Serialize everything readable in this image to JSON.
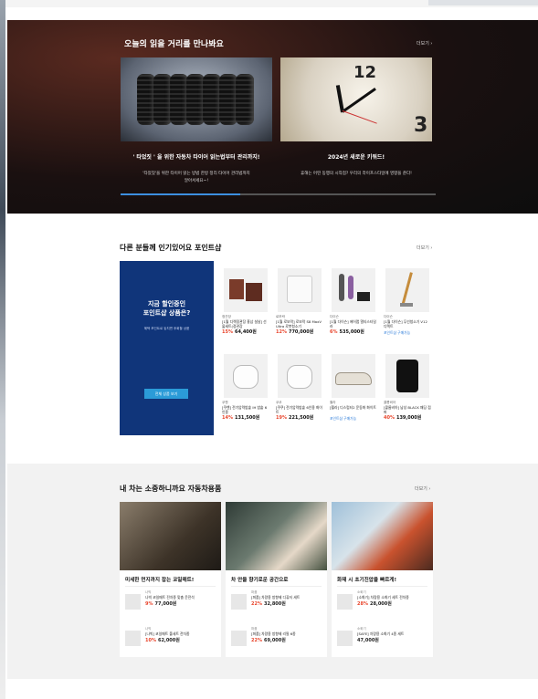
{
  "hero": {
    "title": "오늘의 읽을 거리를 만나봐요",
    "more": "더보기 ›",
    "cards": [
      {
        "title": "' 타었짓 ' 을 위한 자동차 타이어 읽는법부터 관리까지!",
        "desc_1": "'타었짓'을 위한 타이어 읽는 방법 한방 정리 타이어 관리법까지",
        "desc_2": "알아서세요~!"
      },
      {
        "title": "2024년 새로운 키워드!",
        "desc_1": "휴해는 어떤 동행의 시작점? 우리의 라이프스타일에 영향을 준다!",
        "desc_2": ""
      }
    ],
    "clock_digits": "12",
    "clock_small": "3",
    "progress_fraction": 0.38
  },
  "popular": {
    "title": "다른 분들께 인기있어요 포인트샵",
    "more": "더보기 ›",
    "promo_title_1": "지금 할인중인",
    "promo_title_2": "포인트샵 상품은?",
    "promo_sub": "혜택 포인트로 놓치면 후회할 상품",
    "promo_button": "전체 상품 보기",
    "products": [
      {
        "brand": "정관장",
        "name": "[1월 디렉정관장 홍삼 설날] 선물세트(정관장",
        "orig": "",
        "discount": "15%",
        "price": "64,400원",
        "tag": "",
        "icon": "gift-box-icon"
      },
      {
        "brand": "로보락",
        "name": "[1월 로보락] 로보락 S8 MaxV Ultra 로봇청소기",
        "orig": "",
        "discount": "12%",
        "price": "770,000원",
        "tag": "",
        "icon": "robot-vacuum-icon"
      },
      {
        "brand": "다이슨",
        "name": "[1월 다이슨] 에어랩 멀티스타일러",
        "orig": "",
        "discount": "6%",
        "price": "535,000원",
        "tag": "",
        "icon": "hair-styler-icon"
      },
      {
        "brand": "다이슨",
        "name": "[1월 다이슨] 무선청소기 V12 디텍트",
        "orig": "",
        "discount": "",
        "price": "",
        "tag": "포인트샵 구매가능",
        "icon": "stick-vacuum-icon"
      },
      {
        "brand": "쿠첸",
        "name": "[쿠첸] 전기압력밥솥 IH 밥솥 6인용",
        "orig": "",
        "discount": "14%",
        "price": "131,500원",
        "tag": "",
        "icon": "rice-cooker-icon"
      },
      {
        "brand": "쿠쿠",
        "name": "[쿠쿠] 전기압력밥솥 6인용 화이트",
        "orig": "",
        "discount": "19%",
        "price": "221,500원",
        "tag": "",
        "icon": "rice-cooker-icon"
      },
      {
        "brand": "휠라",
        "name": "[휠라] 디스럽터2 운동화 화이트",
        "orig": "",
        "discount": "",
        "price": "",
        "tag": "포인트샵 구매가능",
        "icon": "sneaker-icon"
      },
      {
        "brand": "콜롬비아",
        "name": "[콜롬비아] 남성 BLACK 패딩 점퍼",
        "orig": "",
        "discount": "40%",
        "price": "139,000원",
        "tag": "",
        "icon": "jacket-icon"
      }
    ]
  },
  "car": {
    "title": "내 차는 소중하니까요 자동차용품",
    "more": "더보기 ›",
    "columns": [
      {
        "heading": "미세한 먼지까지 잡는 코일매트!",
        "items": [
          {
            "brand": "나빅",
            "name": "나빅 코일매트 전차종 맞춤 운전석",
            "orig": "",
            "discount": "9%",
            "price": "77,000원"
          },
          {
            "brand": "나빅",
            "name": "[나빅] 코일매트 풀세트 전차종",
            "orig": "",
            "discount": "10%",
            "price": "62,000원"
          }
        ]
      },
      {
        "heading": "차 안을 향기로운 공간으로",
        "items": [
          {
            "brand": "퍼퓸",
            "name": "[퍼퓸] 차량용 방향제 디퓨저 세트",
            "orig": "",
            "discount": "22%",
            "price": "32,800원"
          },
          {
            "brand": "퍼퓸",
            "name": "[퍼퓸] 차량용 방향제 리필 6종",
            "orig": "",
            "discount": "22%",
            "price": "69,000원"
          }
        ]
      },
      {
        "heading": "화재 시 초기진압을 빠르게!",
        "items": [
          {
            "brand": "소화기",
            "name": "[소화기] 차량용 소화기 세트 전차종",
            "orig": "",
            "discount": "28%",
            "price": "28,000원"
          },
          {
            "brand": "소화기",
            "name": "[SAFE] 차량용 소화기 4종 세트",
            "orig": "",
            "discount": "",
            "price": "47,000원"
          }
        ]
      }
    ]
  }
}
